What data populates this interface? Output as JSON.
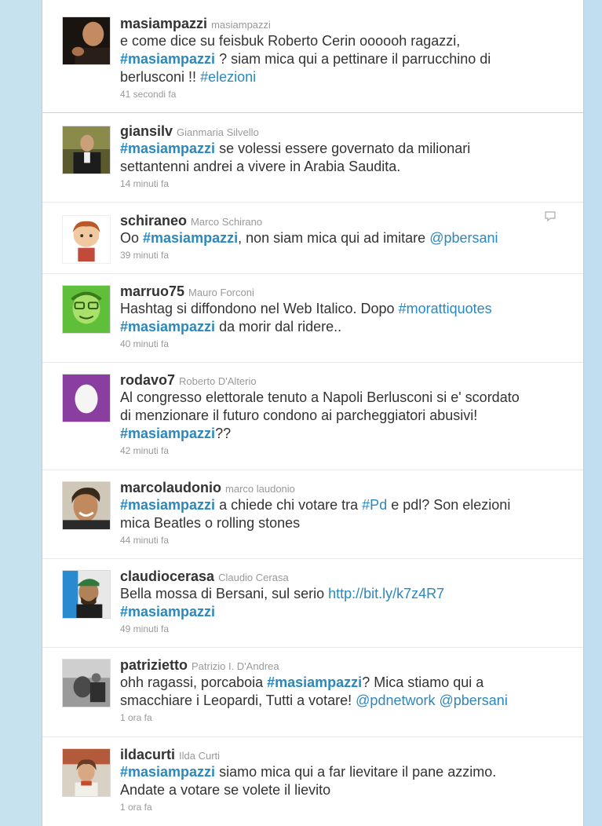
{
  "tweets": [
    {
      "screen_name": "masiampazzi",
      "full_name": "masiampazzi",
      "avatar": "avatar-dark-man-portrait",
      "parts": [
        {
          "t": "text",
          "v": "e come dice su feisbuk Roberto Cerin oooooh ragazzi,"
        },
        {
          "t": "br"
        },
        {
          "t": "hl",
          "v": "#masiampazzi"
        },
        {
          "t": "text",
          "v": " ? siam mica qui a pettinare il parrucchino di"
        },
        {
          "t": "br"
        },
        {
          "t": "text",
          "v": "berlusconi !! "
        },
        {
          "t": "tag",
          "v": "#elezioni"
        }
      ],
      "time": "41 secondi fa"
    },
    {
      "screen_name": "giansilv",
      "full_name": "Gianmaria Silvello",
      "avatar": "avatar-man-suit",
      "parts": [
        {
          "t": "hl",
          "v": "#masiampazzi"
        },
        {
          "t": "text",
          "v": " se volessi essere governato da milionari"
        },
        {
          "t": "br"
        },
        {
          "t": "text",
          "v": "settantenni andrei a vivere in Arabia Saudita."
        }
      ],
      "time": "14 minuti fa"
    },
    {
      "screen_name": "schiraneo",
      "full_name": "Marco Schirano",
      "avatar": "avatar-cartoon-boy",
      "parts": [
        {
          "t": "text",
          "v": "Oo "
        },
        {
          "t": "hl",
          "v": "#masiampazzi"
        },
        {
          "t": "text",
          "v": ", non siam mica qui ad imitare "
        },
        {
          "t": "mention",
          "v": "@pbersani"
        }
      ],
      "time": "39 minuti fa",
      "reply_icon": "speech-bubble-icon"
    },
    {
      "screen_name": "marruo75",
      "full_name": "Mauro Forconi",
      "avatar": "avatar-green-cartoon",
      "parts": [
        {
          "t": "text",
          "v": "Hashtag si diffondono nel Web Italico. Dopo "
        },
        {
          "t": "tag",
          "v": "#morattiquotes"
        },
        {
          "t": "br"
        },
        {
          "t": "hl",
          "v": "#masiampazzi"
        },
        {
          "t": "text",
          "v": " da morir dal ridere.."
        }
      ],
      "time": "40 minuti fa"
    },
    {
      "screen_name": "rodavo7",
      "full_name": "Roberto D'Alterio",
      "avatar": "avatar-default-egg",
      "parts": [
        {
          "t": "text",
          "v": "Al congresso elettorale tenuto a Napoli Berlusconi si e' scordato"
        },
        {
          "t": "br"
        },
        {
          "t": "text",
          "v": "di menzionare il futuro condono ai parcheggiatori abusivi!"
        },
        {
          "t": "br"
        },
        {
          "t": "hl",
          "v": "#masiampazzi"
        },
        {
          "t": "text",
          "v": "??"
        }
      ],
      "time": "42 minuti fa"
    },
    {
      "screen_name": "marcolaudonio",
      "full_name": "marco laudonio",
      "avatar": "avatar-smiling-man",
      "parts": [
        {
          "t": "hl",
          "v": "#masiampazzi"
        },
        {
          "t": "text",
          "v": " a chiede chi votare tra "
        },
        {
          "t": "tag",
          "v": "#Pd"
        },
        {
          "t": "text",
          "v": " e pdl? Son elezioni"
        },
        {
          "t": "br"
        },
        {
          "t": "text",
          "v": "mica Beatles o rolling stones"
        }
      ],
      "time": "44 minuti fa"
    },
    {
      "screen_name": "claudiocerasa",
      "full_name": "Claudio Cerasa",
      "avatar": "avatar-man-green-cap",
      "parts": [
        {
          "t": "text",
          "v": "Bella mossa di Bersani, sul serio "
        },
        {
          "t": "link",
          "v": "http://bit.ly/k7z4R7"
        },
        {
          "t": "br"
        },
        {
          "t": "hl",
          "v": "#masiampazzi"
        }
      ],
      "time": "49 minuti fa"
    },
    {
      "screen_name": "patrizietto",
      "full_name": "Patrizio I. D'Andrea",
      "avatar": "avatar-bw-photo",
      "parts": [
        {
          "t": "text",
          "v": "ohh ragassi, porcaboia "
        },
        {
          "t": "hl",
          "v": "#masiampazzi"
        },
        {
          "t": "text",
          "v": "? Mica stiamo qui a"
        },
        {
          "t": "br"
        },
        {
          "t": "text",
          "v": "smacchiare i Leopardi, Tutti a votare! "
        },
        {
          "t": "mention",
          "v": "@pdnetwork"
        },
        {
          "t": "text",
          "v": " "
        },
        {
          "t": "mention",
          "v": "@pbersani"
        }
      ],
      "time": "1 ora fa"
    },
    {
      "screen_name": "ildacurti",
      "full_name": "Ilda Curti",
      "avatar": "avatar-woman-outdoors",
      "parts": [
        {
          "t": "hl",
          "v": "#masiampazzi"
        },
        {
          "t": "text",
          "v": " siamo mica qui a far lievitare il pane azzimo."
        },
        {
          "t": "br"
        },
        {
          "t": "text",
          "v": "Andate a votare se volete il lievito"
        }
      ],
      "time": "1 ora fa"
    }
  ]
}
